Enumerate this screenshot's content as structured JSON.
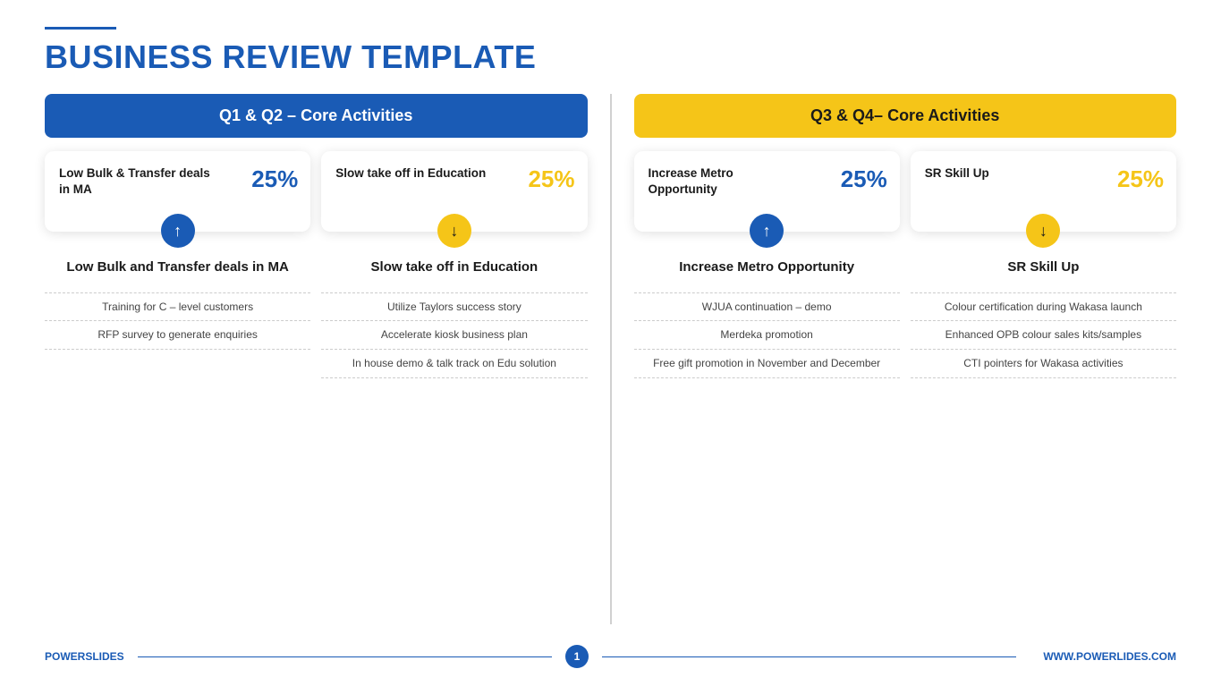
{
  "header": {
    "line": true,
    "title_black": "BUSINESS REVIEW ",
    "title_blue": "TEMPLATE"
  },
  "left_panel": {
    "header_label": "Q1 & Q2 – Core Activities",
    "header_color": "blue",
    "cards": [
      {
        "title": "Low Bulk & Transfer deals in MA",
        "percent": "25%",
        "percent_color": "blue",
        "icon_color": "blue",
        "icon_direction": "up"
      },
      {
        "title": "Slow take off in Education",
        "percent": "25%",
        "percent_color": "yellow",
        "icon_color": "yellow",
        "icon_direction": "down"
      }
    ],
    "items": [
      {
        "title": "Low Bulk and Transfer deals in MA",
        "list": [
          "Training for C – level customers",
          "RFP survey to generate enquiries"
        ]
      },
      {
        "title": "Slow take off in Education",
        "list": [
          "Utilize Taylors success story",
          "Accelerate kiosk business plan",
          "In house demo & talk track on Edu solution"
        ]
      }
    ]
  },
  "right_panel": {
    "header_label": "Q3 & Q4– Core Activities",
    "header_color": "yellow",
    "cards": [
      {
        "title": "Increase Metro Opportunity",
        "percent": "25%",
        "percent_color": "blue",
        "icon_color": "blue",
        "icon_direction": "up"
      },
      {
        "title": "SR Skill Up",
        "percent": "25%",
        "percent_color": "yellow",
        "icon_color": "yellow",
        "icon_direction": "down"
      }
    ],
    "items": [
      {
        "title": "Increase Metro Opportunity",
        "list": [
          "WJUA continuation – demo",
          "Merdeka promotion",
          "Free gift promotion in November and December"
        ]
      },
      {
        "title": "SR Skill Up",
        "list": [
          "Colour certification during Wakasa launch",
          "Enhanced OPB colour sales kits/samples",
          "CTI pointers for Wakasa activities"
        ]
      }
    ]
  },
  "footer": {
    "brand_black": "POWER",
    "brand_blue": "SLIDES",
    "page_number": "1",
    "url": "WWW.POWERLIDES.COM"
  }
}
